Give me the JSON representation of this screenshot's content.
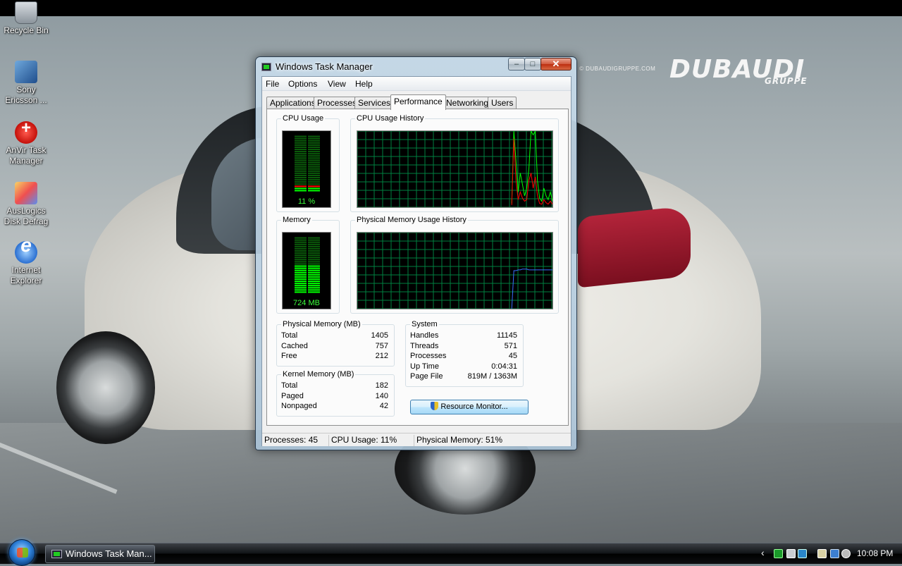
{
  "wallpaper": {
    "brand": "DUBAUDI",
    "brand_sub": "GRUPPE",
    "brand_url": "© DUBAUDIGRUPPE.COM"
  },
  "desktop_icons": [
    {
      "label": "Recycle Bin",
      "icon": "recycle-bin-icon"
    },
    {
      "label": "Sony Ericsson ...",
      "icon": "sony-ericsson-icon"
    },
    {
      "label": "AnVir Task Manager",
      "icon": "anvir-icon"
    },
    {
      "label": "AusLogics Disk Defrag",
      "icon": "auslogics-icon"
    },
    {
      "label": "Internet Explorer",
      "icon": "internet-explorer-icon"
    }
  ],
  "window": {
    "title": "Windows Task Manager",
    "caption_buttons": {
      "minimize": "–",
      "maximize": "□",
      "close": "✕"
    },
    "menu": [
      "File",
      "Options",
      "View",
      "Help"
    ],
    "tabs": [
      "Applications",
      "Processes",
      "Services",
      "Performance",
      "Networking",
      "Users"
    ],
    "active_tab": "Performance",
    "cpu": {
      "meter_label": "CPU Usage",
      "history_label": "CPU Usage History",
      "value_text": "11 %",
      "value": 11,
      "history_green": [
        0,
        0,
        0,
        0,
        0,
        0,
        0,
        0,
        0,
        0,
        0,
        0,
        0,
        0,
        0,
        0,
        0,
        0,
        0,
        0,
        0,
        0,
        0,
        0,
        0,
        0,
        0,
        0,
        0,
        0,
        0,
        0,
        0,
        0,
        0,
        0,
        0,
        0,
        0,
        0,
        0,
        0,
        0,
        0,
        0,
        0,
        0,
        0,
        0,
        0,
        0,
        0,
        0,
        0,
        0,
        0,
        0,
        0,
        0,
        0,
        0,
        0,
        0,
        0,
        0,
        0,
        0,
        0,
        0,
        0,
        0,
        0,
        5,
        100,
        60,
        20,
        45,
        30,
        15,
        25,
        50,
        100,
        95,
        100,
        35,
        12,
        8,
        25,
        15,
        10,
        20,
        8
      ],
      "history_red": [
        0,
        0,
        0,
        0,
        0,
        0,
        0,
        0,
        0,
        0,
        0,
        0,
        0,
        0,
        0,
        0,
        0,
        0,
        0,
        0,
        0,
        0,
        0,
        0,
        0,
        0,
        0,
        0,
        0,
        0,
        0,
        0,
        0,
        0,
        0,
        0,
        0,
        0,
        0,
        0,
        0,
        0,
        0,
        0,
        0,
        0,
        0,
        0,
        0,
        0,
        0,
        0,
        0,
        0,
        0,
        0,
        0,
        0,
        0,
        0,
        0,
        0,
        0,
        0,
        0,
        0,
        0,
        0,
        0,
        0,
        0,
        0,
        3,
        90,
        35,
        10,
        20,
        12,
        8,
        10,
        35,
        45,
        25,
        40,
        15,
        5,
        4,
        10,
        6,
        4,
        8,
        4
      ]
    },
    "memory": {
      "meter_label": "Memory",
      "history_label": "Physical Memory Usage History",
      "value_text": "724 MB",
      "value": 51,
      "history": [
        0,
        0,
        0,
        0,
        0,
        0,
        0,
        0,
        0,
        0,
        0,
        0,
        0,
        0,
        0,
        0,
        0,
        0,
        0,
        0,
        0,
        0,
        0,
        0,
        0,
        0,
        0,
        0,
        0,
        0,
        0,
        0,
        0,
        0,
        0,
        0,
        0,
        0,
        0,
        0,
        0,
        0,
        0,
        0,
        0,
        0,
        0,
        0,
        0,
        0,
        0,
        0,
        0,
        0,
        0,
        0,
        0,
        0,
        0,
        0,
        0,
        0,
        0,
        0,
        0,
        0,
        0,
        0,
        0,
        0,
        0,
        0,
        0,
        50,
        50,
        51,
        51,
        52,
        52,
        52,
        51,
        51,
        51,
        51,
        51,
        51,
        51,
        51,
        51,
        51,
        51,
        51
      ]
    },
    "physical_memory": {
      "label": "Physical Memory (MB)",
      "rows": [
        {
          "label": "Total",
          "value": "1405"
        },
        {
          "label": "Cached",
          "value": "757"
        },
        {
          "label": "Free",
          "value": "212"
        }
      ]
    },
    "kernel_memory": {
      "label": "Kernel Memory (MB)",
      "rows": [
        {
          "label": "Total",
          "value": "182"
        },
        {
          "label": "Paged",
          "value": "140"
        },
        {
          "label": "Nonpaged",
          "value": "42"
        }
      ]
    },
    "system": {
      "label": "System",
      "rows": [
        {
          "label": "Handles",
          "value": "11145"
        },
        {
          "label": "Threads",
          "value": "571"
        },
        {
          "label": "Processes",
          "value": "45"
        },
        {
          "label": "Up Time",
          "value": "0:04:31"
        },
        {
          "label": "Page File",
          "value": "819M / 1363M"
        }
      ]
    },
    "resource_monitor_button": "Resource Monitor...",
    "status": {
      "processes": "Processes: 45",
      "cpu": "CPU Usage: 11%",
      "memory": "Physical Memory: 51%"
    }
  },
  "taskbar": {
    "task_label": "Windows Task Man...",
    "clock": "10:08 PM",
    "tray_chevron": "‹",
    "colors": {
      "cpu_green": "#00ff00",
      "cpu_red": "#ff0000",
      "mem_blue": "#3a6fff",
      "grid": "#008040"
    }
  }
}
